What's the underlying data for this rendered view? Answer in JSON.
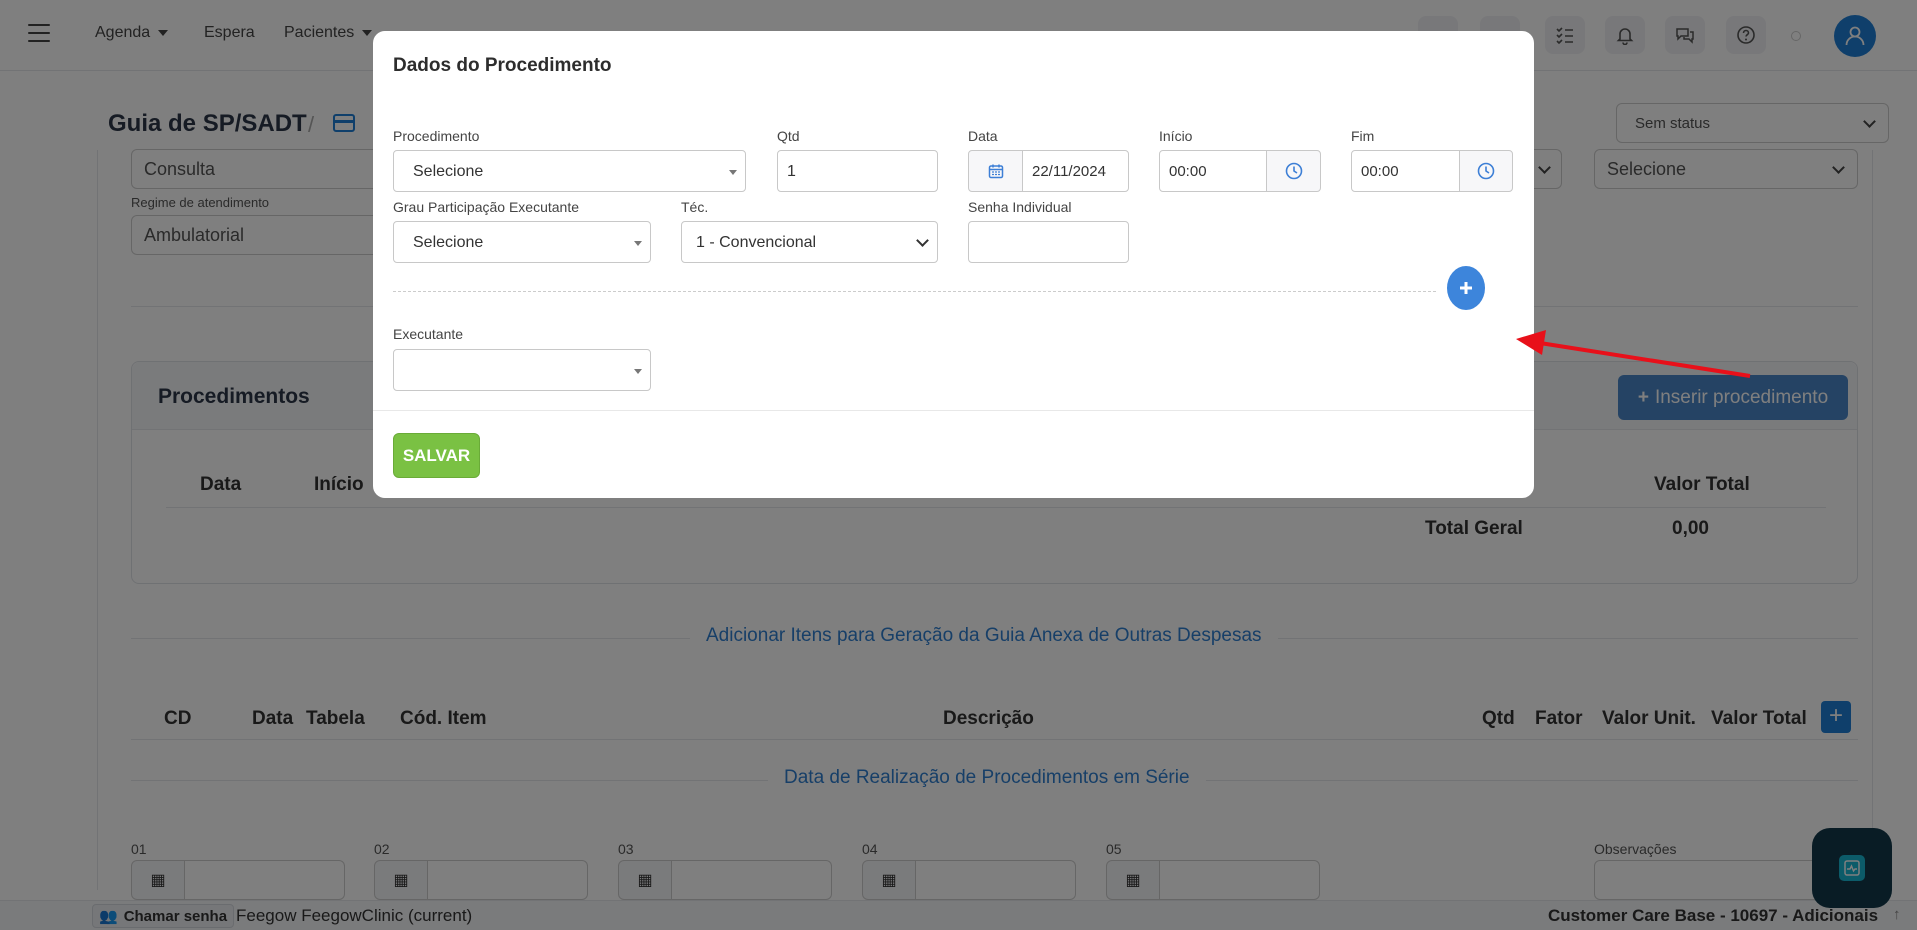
{
  "nav": {
    "items": [
      {
        "label": "Agenda",
        "caret": true
      },
      {
        "label": "Espera",
        "caret": false
      },
      {
        "label": "Pacientes",
        "caret": true
      }
    ]
  },
  "page": {
    "title": "Guia de SP/SADT",
    "status_value": "Sem status"
  },
  "form": {
    "consulta_value": "Consulta",
    "right_select_value": "Selecione",
    "regime_label": "Regime de atendimento",
    "regime_value": "Ambulatorial"
  },
  "procedures": {
    "title": "Procedimentos",
    "insert_label": "Inserir procedimento",
    "headers": {
      "data": "Data",
      "inicio": "Início",
      "valor_total": "Valor Total"
    },
    "total_label": "Total Geral",
    "total_value": "0,00"
  },
  "anexa": {
    "section_title": "Adicionar Itens para Geração da Guia Anexa de Outras Despesas",
    "headers": [
      "CD",
      "Data",
      "Tabela",
      "Cód. Item",
      "Descrição",
      "Qtd",
      "Fator",
      "Valor Unit.",
      "Valor Total"
    ]
  },
  "serie": {
    "section_title": "Data de Realização de Procedimentos em Série",
    "labels": [
      "01",
      "02",
      "03",
      "04",
      "05"
    ],
    "obs_label": "Observações"
  },
  "footer": {
    "call_label": "Chamar senha",
    "clinic": "Feegow FeegowClinic (current)",
    "base": "Customer Care Base - 10697 - Adicionais"
  },
  "modal": {
    "title": "Dados do Procedimento",
    "procedimento": {
      "label": "Procedimento",
      "value": "Selecione"
    },
    "qtd": {
      "label": "Qtd",
      "value": "1"
    },
    "data": {
      "label": "Data",
      "value": "22/11/2024"
    },
    "inicio": {
      "label": "Início",
      "value": "00:00"
    },
    "fim": {
      "label": "Fim",
      "value": "00:00"
    },
    "grau": {
      "label": "Grau Participação Executante",
      "value": "Selecione"
    },
    "tec": {
      "label": "Téc.",
      "value": "1 - Convencional"
    },
    "senha": {
      "label": "Senha Individual",
      "value": ""
    },
    "executante": {
      "label": "Executante",
      "value": ""
    },
    "save_label": "SALVAR"
  },
  "colors": {
    "primary": "#1f7fd6",
    "save": "#7ac143",
    "annotation_arrow": "#e8101a"
  }
}
